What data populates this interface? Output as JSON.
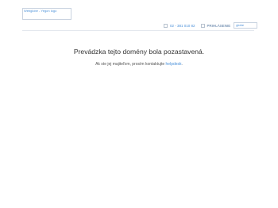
{
  "header": {
    "logo_placeholder": "Webglobe - Yegon logo",
    "phone": "02 - 381 010 82",
    "login_label": "PRIHLÁSENIE",
    "search_label": "globe"
  },
  "main": {
    "headline": "Prevádzka tejto domény bola pozastavená.",
    "subline_prefix": "Ak ste jej majiteľom, prosím kontaktujte ",
    "helpdesk_link": "helpdesk",
    "subline_suffix": "."
  },
  "colors": {
    "accent": "#4a90d9",
    "text": "#333333",
    "border": "#c9d3e0"
  }
}
